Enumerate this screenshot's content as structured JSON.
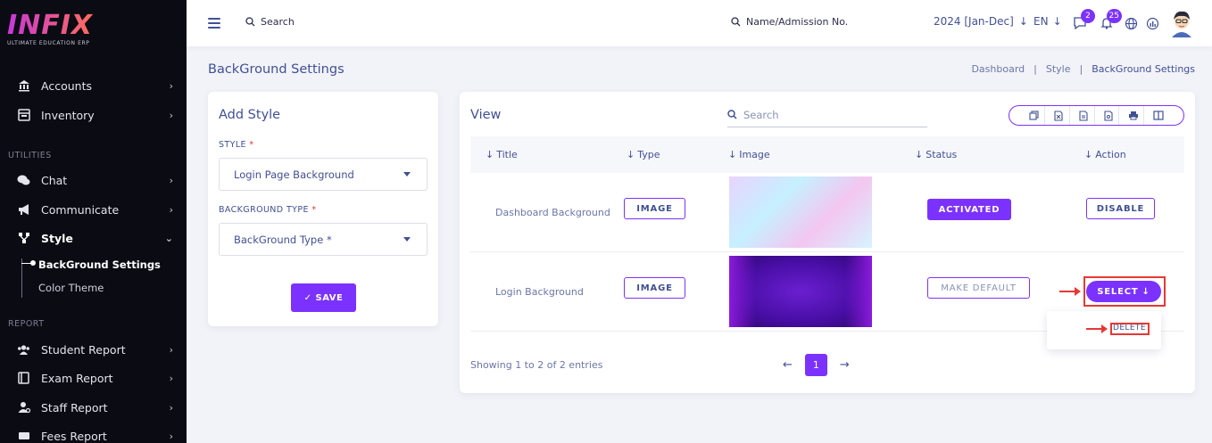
{
  "brand": {
    "logo_text": "INFIX",
    "tagline": "ULTIMATE EDUCATION ERP"
  },
  "sidebar": {
    "items_top": [
      {
        "label": "Accounts",
        "icon": "bank-icon"
      },
      {
        "label": "Inventory",
        "icon": "inventory-icon"
      }
    ],
    "section_utilities": "UTILITIES",
    "items_utilities": [
      {
        "label": "Chat",
        "icon": "chat-icon"
      },
      {
        "label": "Communicate",
        "icon": "megaphone-icon"
      },
      {
        "label": "Style",
        "icon": "style-icon"
      }
    ],
    "style_sub": [
      {
        "label": "BackGround Settings"
      },
      {
        "label": "Color Theme"
      }
    ],
    "section_report": "REPORT",
    "items_report": [
      {
        "label": "Student Report",
        "icon": "users-icon"
      },
      {
        "label": "Exam Report",
        "icon": "book-icon"
      },
      {
        "label": "Staff Report",
        "icon": "staff-icon"
      },
      {
        "label": "Fees Report",
        "icon": "fees-icon"
      }
    ]
  },
  "topbar": {
    "search_label": "Search",
    "search_student_label": "Name/Admission No.",
    "session": "2024 [Jan-Dec]",
    "language": "EN",
    "messages_count": "2",
    "notifications_count": "25"
  },
  "page": {
    "title": "BackGround Settings",
    "breadcrumb": [
      "Dashboard",
      "Style",
      "BackGround Settings"
    ]
  },
  "add_style": {
    "title": "Add Style",
    "style_label": "STYLE",
    "style_value": "Login Page Background",
    "bg_type_label": "BACKGROUND TYPE",
    "bg_type_placeholder": "BackGround Type *",
    "save_label": "SAVE"
  },
  "view": {
    "title": "View",
    "search_placeholder": "Search",
    "columns": [
      "Title",
      "Type",
      "Image",
      "Status",
      "Action"
    ],
    "rows": [
      {
        "title": "Dashboard Background",
        "type": "IMAGE",
        "status": "ACTIVATED",
        "action": "DISABLE"
      },
      {
        "title": "Login Background",
        "type": "IMAGE",
        "status": "MAKE DEFAULT",
        "action": "SELECT"
      }
    ],
    "dropdown_item": "DELETE",
    "footer": "Showing 1 to 2 of 2 entries",
    "current_page": "1"
  },
  "colors": {
    "accent": "#7c32ff",
    "text": "#415094",
    "sidebar_bg": "#0b0b14",
    "highlight": "#e53935"
  }
}
